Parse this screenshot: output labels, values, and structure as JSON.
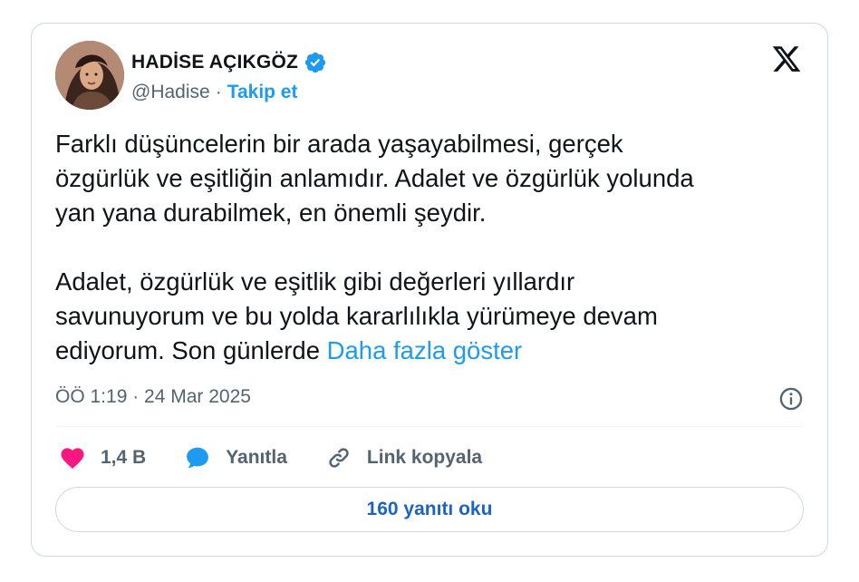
{
  "author": {
    "display_name": "HADİSE AÇIKGÖZ",
    "handle": "@Hadise",
    "separator": "·",
    "follow_label": "Takip et"
  },
  "tweet": {
    "body": "Farklı düşüncelerin bir arada yaşayabilmesi, gerçek\nözgürlük ve eşitliğin anlamıdır. Adalet ve özgürlük yolunda\nyan yana durabilmek, en önemli şeydir.\n\nAdalet, özgürlük ve eşitlik gibi değerleri yıllardır\nsavunuyorum ve bu yolda kararlılıkla yürümeye devam\nediyorum. Son günlerde ",
    "show_more_label": "Daha fazla göster",
    "timestamp": "ÖÖ 1:19 · 24 Mar 2025"
  },
  "actions": {
    "likes": "1,4 B",
    "reply_label": "Yanıtla",
    "copy_link_label": "Link kopyala"
  },
  "replies_button_label": "160 yanıtı oku",
  "colors": {
    "accent": "#1d9bf0",
    "like": "#f91880",
    "muted": "#536471",
    "border": "#cfd9de"
  },
  "icons": [
    "verified-badge-icon",
    "x-logo-icon",
    "info-icon",
    "heart-icon",
    "reply-bubble-icon",
    "link-icon"
  ]
}
